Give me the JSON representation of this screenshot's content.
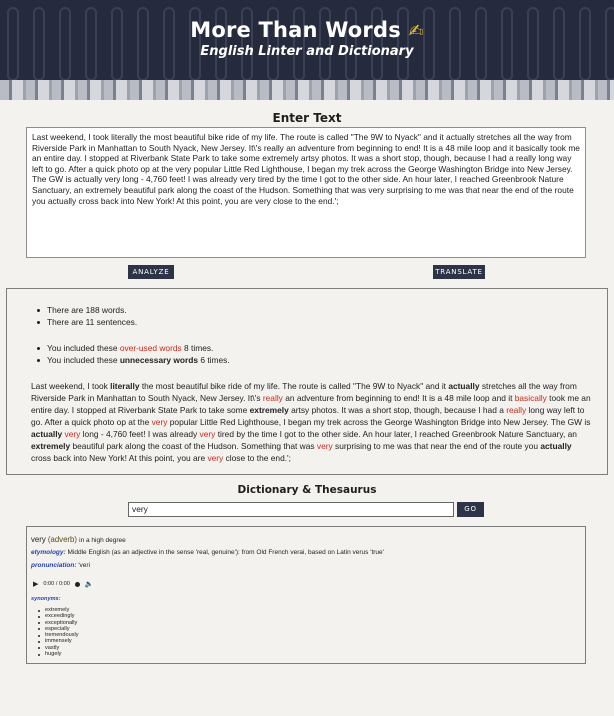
{
  "header": {
    "title": "More Than Words",
    "title_icon": "writing-hand-icon",
    "subtitle": "English Linter and Dictionary"
  },
  "input_section": {
    "heading": "Enter Text",
    "text": "Last weekend, I took literally the most beautiful bike ride of my life. The route is called \"The 9W to Nyack\" and it actually stretches all the way from Riverside Park in Manhattan to South Nyack, New Jersey. It\\'s really an adventure from beginning to end! It is a 48 mile loop and it basically took me an entire day. I stopped at Riverbank State Park to take some extremely artsy photos. It was a short stop, though, because I had a really long way left to go. After a quick photo op at the very popular Little Red Lighthouse, I began my trek across the George Washington Bridge into New Jersey.  The GW is actually very long - 4,760 feet! I was already very tired by the time I got to the other side.  An hour later, I reached Greenbrook Nature Sanctuary, an extremely beautiful park along the coast of the Hudson.  Something that was very surprising to me was that near the end of the route you actually cross back into New York! At this point, you are very close to the end.';",
    "analyze_label": "ANALYZE",
    "translate_label": "TRANSLATE"
  },
  "analysis": {
    "word_count": "There are 188 words.",
    "sentence_count": "There are 11 sentences.",
    "overused_prefix": "You included these ",
    "overused_link": "over-used words",
    "overused_suffix": " 8 times.",
    "unnecessary_prefix": "You included these ",
    "unnecessary_bold": "unnecessary words",
    "unnecessary_suffix": " 6 times.",
    "segments": [
      {
        "t": "Last weekend, I took ",
        "s": ""
      },
      {
        "t": "literally",
        "s": "b"
      },
      {
        "t": " the most beautiful bike ride of my life. The route is called \"The 9W to Nyack\" and it ",
        "s": ""
      },
      {
        "t": "actually",
        "s": "b"
      },
      {
        "t": " stretches all the way from Riverside Park in Manhattan to South Nyack, New Jersey. It\\'s ",
        "s": ""
      },
      {
        "t": "really",
        "s": "red"
      },
      {
        "t": " an adventure from beginning to end! It is a 48 mile loop and it ",
        "s": ""
      },
      {
        "t": "basically",
        "s": "red"
      },
      {
        "t": " took me an entire day. I stopped at Riverbank State Park to take some ",
        "s": ""
      },
      {
        "t": "extremely",
        "s": "b"
      },
      {
        "t": " artsy photos. It was a short stop, though, because I had a ",
        "s": ""
      },
      {
        "t": "really",
        "s": "red"
      },
      {
        "t": " long way left to go. After a quick photo op at the ",
        "s": ""
      },
      {
        "t": "very",
        "s": "red"
      },
      {
        "t": " popular Little Red Lighthouse, I began my trek across the George Washington Bridge into New Jersey. The GW is ",
        "s": ""
      },
      {
        "t": "actually",
        "s": "b"
      },
      {
        "t": " ",
        "s": ""
      },
      {
        "t": "very",
        "s": "red"
      },
      {
        "t": " long - 4,760 feet! I was already ",
        "s": ""
      },
      {
        "t": "very",
        "s": "red"
      },
      {
        "t": " tired by the time I got to the other side. An hour later, I reached Greenbrook Nature Sanctuary, an ",
        "s": ""
      },
      {
        "t": "extremely",
        "s": "b"
      },
      {
        "t": " beautiful park along the coast of the Hudson. Something that was ",
        "s": ""
      },
      {
        "t": "very",
        "s": "red"
      },
      {
        "t": " surprising to me was that near the end of the route you ",
        "s": ""
      },
      {
        "t": "actually",
        "s": "b"
      },
      {
        "t": " cross back into New York! At this point, you are ",
        "s": ""
      },
      {
        "t": "very",
        "s": "red"
      },
      {
        "t": " close to the end.';",
        "s": ""
      }
    ]
  },
  "dictionary": {
    "heading": "Dictionary & Thesaurus",
    "search_value": "very",
    "go_label": "GO",
    "word": "very",
    "pos": "(adverb)",
    "definition": "in a high degree",
    "etymology_label": "etymology:",
    "etymology": "Middle English (as an adjective in the sense 'real, genuine'): from Old French verai, based on Latin verus 'true'",
    "pronunciation_label": "pronunciation:",
    "pronunciation": "'veri",
    "audio_time": "0:00 / 0:00",
    "synonyms_label": "synonyms:",
    "synonyms": [
      "extremely",
      "exceedingly",
      "exceptionally",
      "especially",
      "tremendously",
      "immensely",
      "vastly",
      "hugely"
    ]
  },
  "colors": {
    "header_bg": "#252b3c",
    "button_bg": "#2e3447",
    "highlight_red": "#c92a1c",
    "label_blue": "#2542a8"
  }
}
